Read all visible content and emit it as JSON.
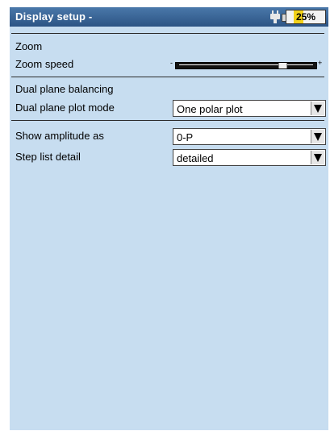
{
  "titlebar": {
    "title": "Display setup -",
    "battery_text": "25%",
    "battery_level": 0.25
  },
  "sections": {
    "zoom_heading": "Zoom",
    "dual_heading": "Dual plane balancing"
  },
  "settings": {
    "zoom_speed": {
      "label": "Zoom speed",
      "level": 0.78,
      "minus": "-",
      "plus": "+"
    },
    "dual_plot_mode": {
      "label": "Dual plane plot mode",
      "value": "One polar plot"
    },
    "amplitude": {
      "label": "Show amplitude as",
      "value": "0-P"
    },
    "step_detail": {
      "label": "Step list detail",
      "value": "detailed"
    }
  },
  "icons": {
    "power": "plug-icon",
    "dropdown": "chevron-down-icon"
  },
  "colors": {
    "background": "#c7ddf0",
    "titlebar": "#3a6797",
    "battery_fill": "#f3d21a"
  }
}
